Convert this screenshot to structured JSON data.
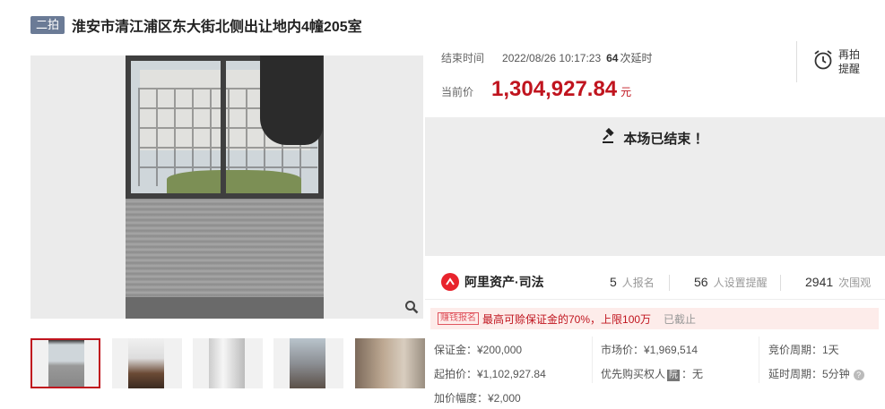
{
  "header": {
    "badge": "二拍",
    "title": "淮安市清江浦区东大街北侧出让地内4幢205室"
  },
  "auction": {
    "end_label": "结束时间",
    "end_time": "2022/08/26 10:17:23",
    "delay_count": "64",
    "delay_unit": "次延时",
    "price_label": "当前价",
    "current_price": "1,304,927.84",
    "price_unit": "元",
    "remind_label": "再拍提醒",
    "status": "本场已结束 ！"
  },
  "platform": {
    "logo_text": "阿里资产·司法",
    "stats": [
      {
        "value": "5",
        "label": "人报名"
      },
      {
        "value": "56",
        "label": "人设置提醒"
      },
      {
        "value": "2941",
        "label": "次围观"
      }
    ]
  },
  "promo": {
    "tag": "赚钱报名",
    "text": "最高可赊保证金的70%，上限100万",
    "status": "已截止"
  },
  "details": {
    "deposit": "保证金：¥200,000",
    "start_price": "起拍价：¥1,102,927.84",
    "increment": "加价幅度：¥2,000",
    "market_price": "市场价：¥1,969,514",
    "priority_label": "优先购买权人",
    "priority_tag": "阮",
    "priority_value": "：无",
    "bid_cycle": "竞价周期：1天",
    "delay_cycle": "延时周期：5分钟"
  },
  "icons": {
    "zoom": "magnifier-icon",
    "remind": "alarm-clock-icon",
    "gavel": "gavel-icon",
    "help": "question-icon"
  },
  "colors": {
    "accent": "#c0141e",
    "badge": "#6b7b96"
  }
}
